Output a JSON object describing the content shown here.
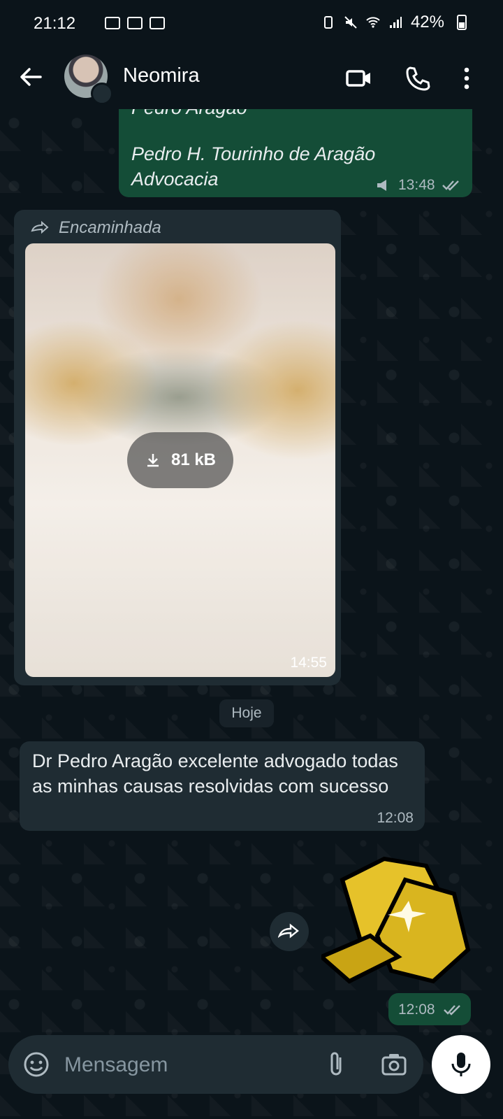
{
  "status_bar": {
    "time": "21:12",
    "battery": "42%"
  },
  "header": {
    "contact_name": "Neomira"
  },
  "messages": {
    "outgoing_card": {
      "line1": "Pedro Aragão",
      "line2": "Pedro H. Tourinho de Aragão",
      "line3": "Advocacia",
      "time": "13:48"
    },
    "forwarded_media": {
      "label": "Encaminhada",
      "size": "81 kB",
      "time": "14:55"
    },
    "date_separator": "Hoje",
    "incoming_text": {
      "text": "Dr Pedro Aragão excelente advogado todas as minhas causas resolvidas com sucesso",
      "time": "12:08"
    },
    "sticker": {
      "time": "12:08"
    }
  },
  "composer": {
    "placeholder": "Mensagem"
  },
  "colors": {
    "background": "#0b141a",
    "outgoing_bubble": "#144d37",
    "incoming_bubble": "#1f2c33",
    "text": "#e9edef",
    "muted": "#aebac1"
  }
}
